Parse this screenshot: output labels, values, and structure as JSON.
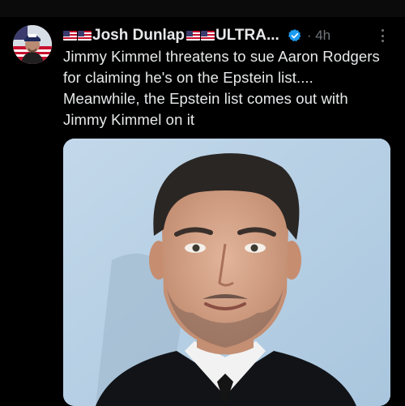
{
  "tweet": {
    "author": {
      "name_prefix": "Josh Dunlap",
      "name_suffix": "ULTRA...",
      "verified": true
    },
    "time": "4h",
    "text": "Jimmy Kimmel threatens to sue Aaron Rodgers for claiming he's on the Epstein list.... Meanwhile, the Epstein list comes out with Jimmy Kimmel on it",
    "media": {
      "kind": "portrait-photo"
    }
  },
  "icons": {
    "verified": "verified-badge-icon",
    "more": "more-options-icon",
    "flag": "us-flag-icon"
  },
  "colors": {
    "background": "#000000",
    "text": "#e7e9ea",
    "muted": "#71767b",
    "verified": "#1d9bf0"
  }
}
